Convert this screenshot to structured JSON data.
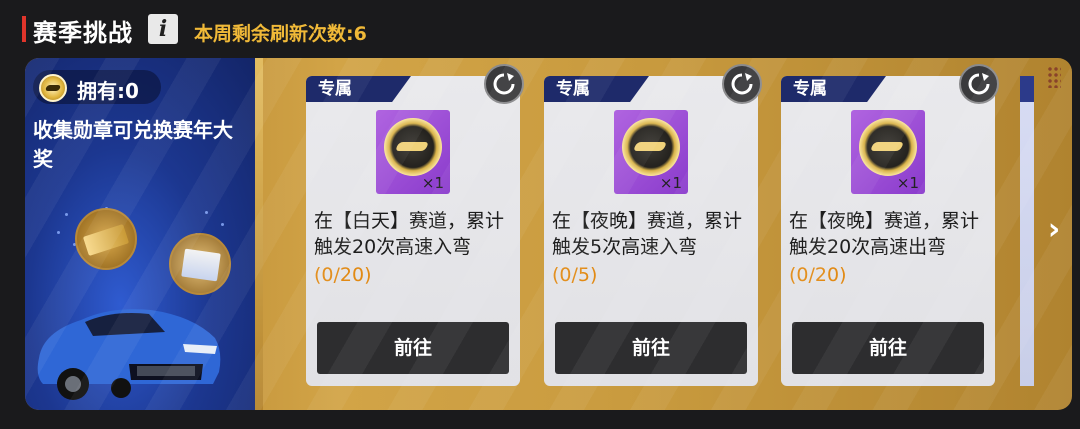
{
  "header": {
    "title": "赛季挑战",
    "info_icon": "i",
    "refresh_text": "本周剩余刷新次数:6"
  },
  "promo": {
    "owned_label": "拥有:0",
    "description": "收集勋章可兑换赛年大奖"
  },
  "cards": [
    {
      "tag": "专属",
      "quantity": "×1",
      "task": "在【白天】赛道，累计触发20次高速入弯",
      "progress": "(0/20)",
      "button": "前往"
    },
    {
      "tag": "专属",
      "quantity": "×1",
      "task": "在【夜晚】赛道，累计触发5次高速入弯",
      "progress": "(0/5)",
      "button": "前往"
    },
    {
      "tag": "专属",
      "quantity": "×1",
      "task": "在【夜晚】赛道，累计触发20次高速出弯",
      "progress": "(0/20)",
      "button": "前往"
    }
  ],
  "colors": {
    "accent_red": "#e0352b",
    "refresh_gold": "#f0b938",
    "progress_orange": "#e28a14",
    "tag_navy": "#1e2a6a",
    "reward_purple": "#9a4bd6"
  }
}
